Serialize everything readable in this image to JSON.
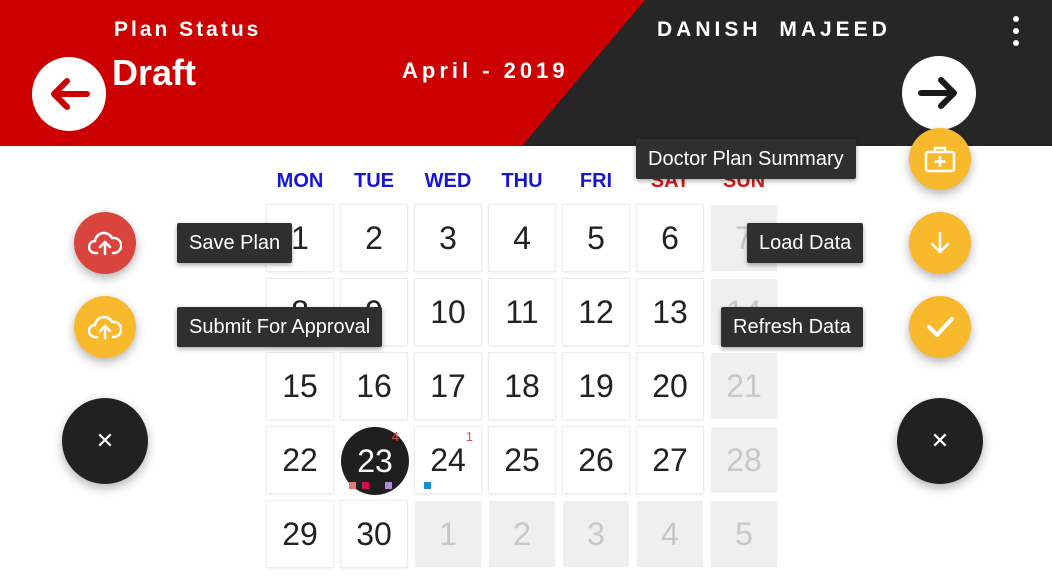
{
  "header": {
    "plan_status_label": "Plan Status",
    "plan_status_value": "Draft",
    "month": "April - 2019",
    "user_name": "DANISH MAJEED",
    "icons": {
      "prev": "arrow-left-icon",
      "next": "arrow-right-icon",
      "menu": "more-vertical-icon"
    }
  },
  "calendar": {
    "weekdays": [
      "MON",
      "TUE",
      "WED",
      "THU",
      "FRI",
      "SAT",
      "SUN"
    ],
    "weekday_colors": [
      "#1515d6",
      "#1515d6",
      "#1515d6",
      "#1515d6",
      "#1515d6",
      "#d61a1a",
      "#d61a1a"
    ],
    "weeks": [
      [
        {
          "d": "1"
        },
        {
          "d": "2"
        },
        {
          "d": "3"
        },
        {
          "d": "4"
        },
        {
          "d": "5"
        },
        {
          "d": "6"
        },
        {
          "d": "7",
          "dim": true
        }
      ],
      [
        {
          "d": "8"
        },
        {
          "d": "9"
        },
        {
          "d": "10"
        },
        {
          "d": "11"
        },
        {
          "d": "12"
        },
        {
          "d": "13"
        },
        {
          "d": "14",
          "dim": true
        }
      ],
      [
        {
          "d": "15"
        },
        {
          "d": "16"
        },
        {
          "d": "17"
        },
        {
          "d": "18"
        },
        {
          "d": "19"
        },
        {
          "d": "20"
        },
        {
          "d": "21",
          "dim": true
        }
      ],
      [
        {
          "d": "22"
        },
        {
          "d": "23",
          "today": true,
          "badge": "4"
        },
        {
          "d": "24",
          "badge": "1"
        },
        {
          "d": "25"
        },
        {
          "d": "26"
        },
        {
          "d": "27"
        },
        {
          "d": "28",
          "dim": true
        }
      ],
      [
        {
          "d": "29"
        },
        {
          "d": "30"
        },
        {
          "d": "1",
          "dim": true
        },
        {
          "d": "2",
          "dim": true
        },
        {
          "d": "3",
          "dim": true
        },
        {
          "d": "4",
          "dim": true
        },
        {
          "d": "5",
          "dim": true
        }
      ]
    ],
    "marker_colors": {
      "today": [
        "#e87878",
        "#d0104a",
        "#b088dd"
      ],
      "24": [
        "#1b8ccc"
      ]
    }
  },
  "fab_left": {
    "save_label": "Save Plan",
    "submit_label": "Submit For Approval",
    "save_icon": "cloud-upload-icon",
    "submit_icon": "cloud-upload-icon",
    "close_icon": "close-icon",
    "close_glyph": "✕"
  },
  "fab_right": {
    "summary_label": "Doctor Plan Summary",
    "load_label": "Load Data",
    "refresh_label": "Refresh Data",
    "summary_icon": "medical-kit-icon",
    "load_icon": "arrow-down-icon",
    "refresh_icon": "check-icon",
    "close_icon": "close-icon",
    "close_glyph": "✕"
  },
  "colors": {
    "header_red": "#cc0000",
    "header_dark": "#262626",
    "fab_yellow": "#f9b92c",
    "fab_red": "#d9453c"
  }
}
